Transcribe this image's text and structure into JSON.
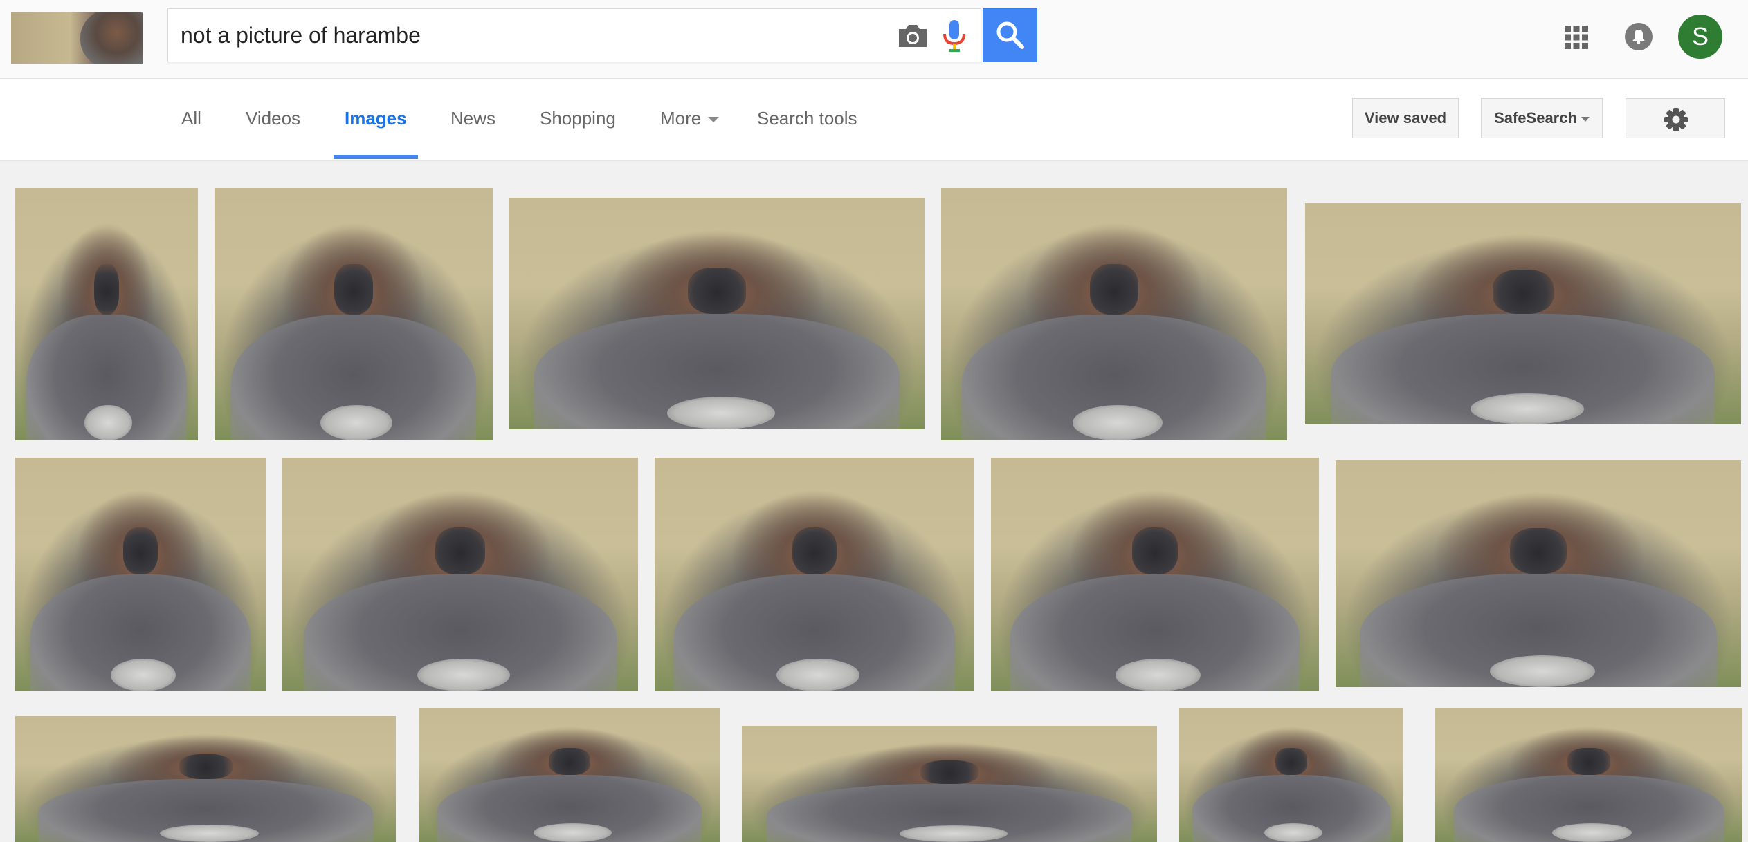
{
  "search": {
    "query": "not a picture of harambe",
    "camera_icon": "camera-icon",
    "mic_icon": "microphone-icon",
    "search_icon": "magnifier-icon"
  },
  "header": {
    "apps_icon": "apps-grid-icon",
    "notification_icon": "bell-icon",
    "avatar_initial": "S",
    "avatar_color": "#2e7d32"
  },
  "nav": {
    "tabs": [
      {
        "label": "All"
      },
      {
        "label": "Videos"
      },
      {
        "label": "Images",
        "active": true
      },
      {
        "label": "News"
      },
      {
        "label": "Shopping"
      },
      {
        "label": "More"
      },
      {
        "label": "Search tools"
      }
    ],
    "view_saved": "View saved",
    "safesearch": "SafeSearch",
    "settings_icon": "gear-icon",
    "accent_color": "#4285f4"
  },
  "results": {
    "rows": [
      {
        "count": 5
      },
      {
        "count": 5
      },
      {
        "count": 5
      }
    ]
  }
}
